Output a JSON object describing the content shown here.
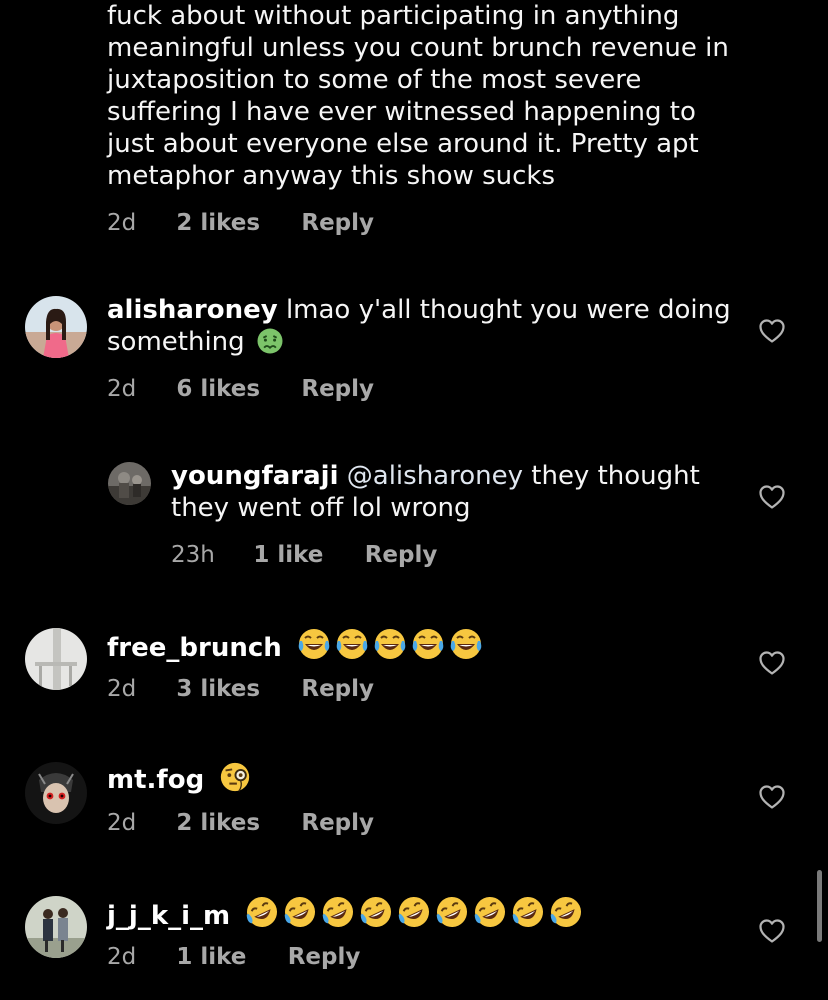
{
  "comments": [
    {
      "text": "fuck about without participating in anything meaningful unless you count brunch revenue in juxtaposition to some of the most severe suffering I have ever witnessed happening to just about everyone else around it. Pretty apt metaphor anyway this show sucks",
      "time": "2d",
      "likes": "2 likes",
      "reply_label": "Reply"
    },
    {
      "username": "alisharoney",
      "text": "lmao y'all thought you were doing something",
      "emoji": "nauseated-face",
      "time": "2d",
      "likes": "6 likes",
      "reply_label": "Reply"
    },
    {
      "username": "youngfaraji",
      "mention": "@alisharoney",
      "text": "they thought they went off lol wrong",
      "time": "23h",
      "likes": "1 like",
      "reply_label": "Reply"
    },
    {
      "username": "free_brunch",
      "emoji": "face-with-tears-of-joy",
      "emoji_count": 5,
      "time": "2d",
      "likes": "3 likes",
      "reply_label": "Reply"
    },
    {
      "username": "mt.fog",
      "emoji": "face-with-monocle",
      "time": "2d",
      "likes": "2 likes",
      "reply_label": "Reply"
    },
    {
      "username": "j_j_k_i_m",
      "emoji": "rolling-on-the-floor-laughing",
      "emoji_count": 9,
      "time": "2d",
      "likes": "1 like",
      "reply_label": "Reply"
    }
  ],
  "icons": {
    "like": "heart-outline-icon"
  },
  "colors": {
    "background": "#000000",
    "text": "#f5f5f5",
    "meta": "#a8a8a8",
    "emoji_yellow": "#f7c740"
  }
}
